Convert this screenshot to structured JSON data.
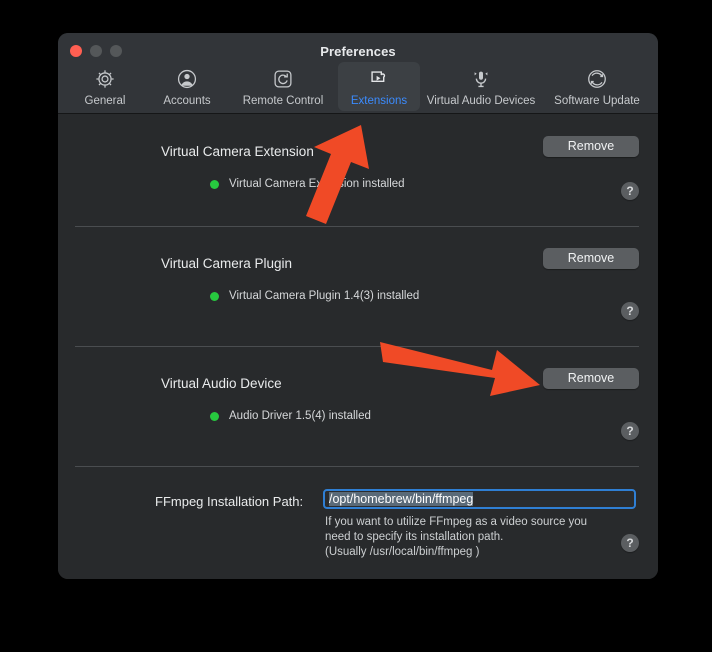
{
  "window": {
    "title": "Preferences",
    "traffic_lights": [
      "close-button",
      "minimize-button",
      "maximize-button"
    ]
  },
  "toolbar": {
    "tabs": [
      {
        "label": "General",
        "icon": "gear-icon",
        "selected": false
      },
      {
        "label": "Accounts",
        "icon": "user-account-icon",
        "selected": false
      },
      {
        "label": "Remote Control",
        "icon": "remote-control-icon",
        "selected": false
      },
      {
        "label": "Extensions",
        "icon": "puzzle-play-icon",
        "selected": true
      },
      {
        "label": "Virtual Audio Devices",
        "icon": "microphone-icon",
        "selected": false
      },
      {
        "label": "Software Update",
        "icon": "refresh-circle-icon",
        "selected": false
      }
    ],
    "selected_tab_color": "#3b8bfd"
  },
  "extensions": {
    "rows": [
      {
        "title": "Virtual Camera Extension",
        "status_text": "Virtual Camera Extension installed",
        "status_color": "#27c93f",
        "button_label": "Remove",
        "help_label": "?"
      },
      {
        "title": "Virtual Camera Plugin",
        "status_text": "Virtual Camera Plugin 1.4(3) installed",
        "status_color": "#27c93f",
        "button_label": "Remove",
        "help_label": "?"
      },
      {
        "title": "Virtual Audio Device",
        "status_text": "Audio Driver 1.5(4) installed",
        "status_color": "#27c93f",
        "button_label": "Remove",
        "help_label": "?"
      }
    ]
  },
  "ffmpeg": {
    "label": "FFmpeg Installation Path:",
    "value": "/opt/homebrew/bin/ffmpeg",
    "placeholder": "/usr/local/bin/ffmpeg",
    "hint": "If you want to utilize FFmpeg as a video source you\nneed to specify its installation path.\n(Usually /usr/local/bin/ffmpeg )",
    "help_label": "?",
    "focus_ring_color": "#2f7fd4",
    "selection_color": "#5a6a78"
  },
  "annotations": {
    "arrow_color": "#f04a26",
    "arrows": [
      {
        "name": "arrow-to-extensions-tab",
        "direction": "up-right"
      },
      {
        "name": "arrow-to-remove-audio-device",
        "direction": "right-down"
      }
    ]
  }
}
